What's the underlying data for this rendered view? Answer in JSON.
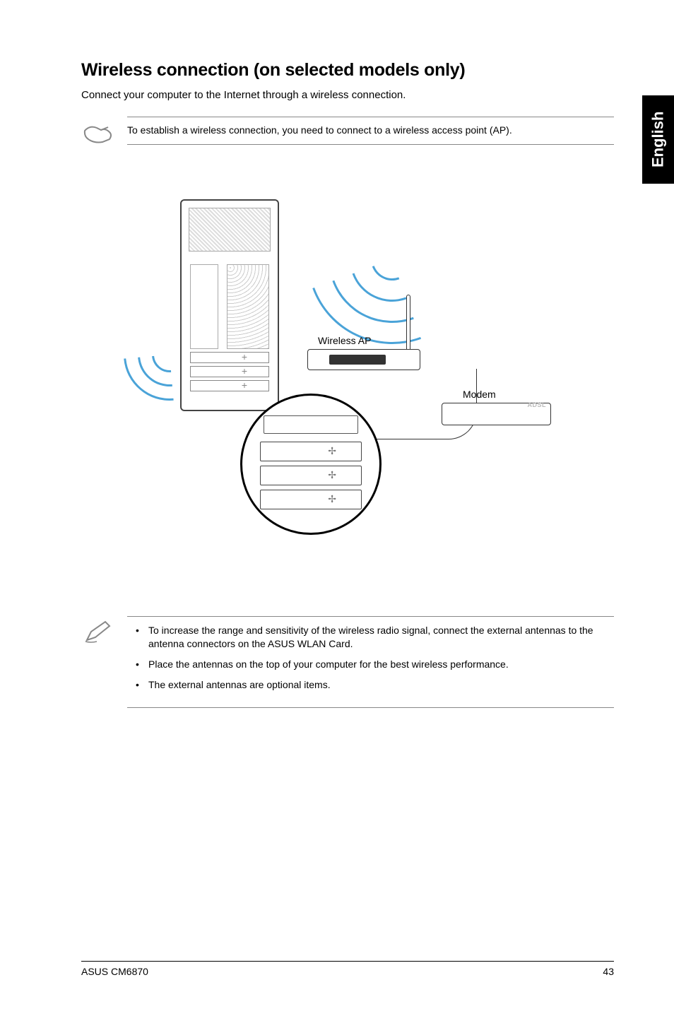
{
  "side_tab": "English",
  "heading": "Wireless connection (on selected models only)",
  "intro": "Connect your computer to the Internet through a wireless connection.",
  "note1": {
    "text": "To establish a wireless connection, you need to connect to a wireless access point (AP)."
  },
  "diagram": {
    "wireless_ap_label": "Wireless AP",
    "modem_label": "Modem"
  },
  "note2": {
    "items": [
      "To increase the range and sensitivity of the wireless radio signal, connect the external antennas to the antenna connectors on the ASUS WLAN Card.",
      "Place the antennas on the top of your computer for the best wireless performance.",
      "The external antennas are optional items."
    ]
  },
  "footer": {
    "product": "ASUS CM6870",
    "page_number": "43"
  }
}
